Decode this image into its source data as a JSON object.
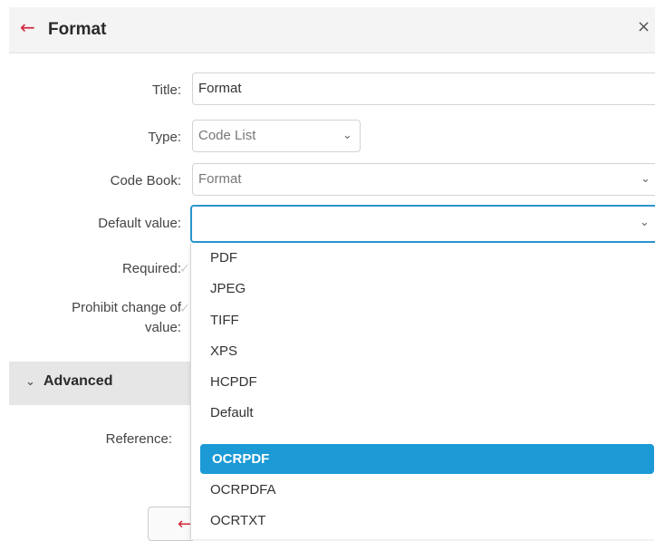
{
  "header": {
    "title": "Format",
    "back_icon": "←",
    "close_icon": "×"
  },
  "form": {
    "title_label": "Title:",
    "title_value": "Format",
    "type_label": "Type:",
    "type_value": "Code List",
    "codebook_label": "Code Book:",
    "codebook_value": "Format",
    "default_label": "Default value:",
    "default_value": "",
    "required_label": "Required:",
    "prohibit_label_line1": "Prohibit change of",
    "prohibit_label_line2": "value:",
    "reference_label": "Reference:"
  },
  "advanced": {
    "label": "Advanced",
    "chevron": "⌄"
  },
  "dropdown": {
    "options": [
      "PDF",
      "JPEG",
      "TIFF",
      "XPS",
      "HCPDF",
      "Default",
      "OCRPDF",
      "OCRPDFA",
      "OCRTXT"
    ],
    "selected": "OCRPDF"
  },
  "icons": {
    "chevron_down": "⌄",
    "back_button_arrow": "←"
  },
  "colors": {
    "accent": "#1b9ad6",
    "focus_border": "#2a95d0",
    "back_arrow": "#d0273e"
  }
}
